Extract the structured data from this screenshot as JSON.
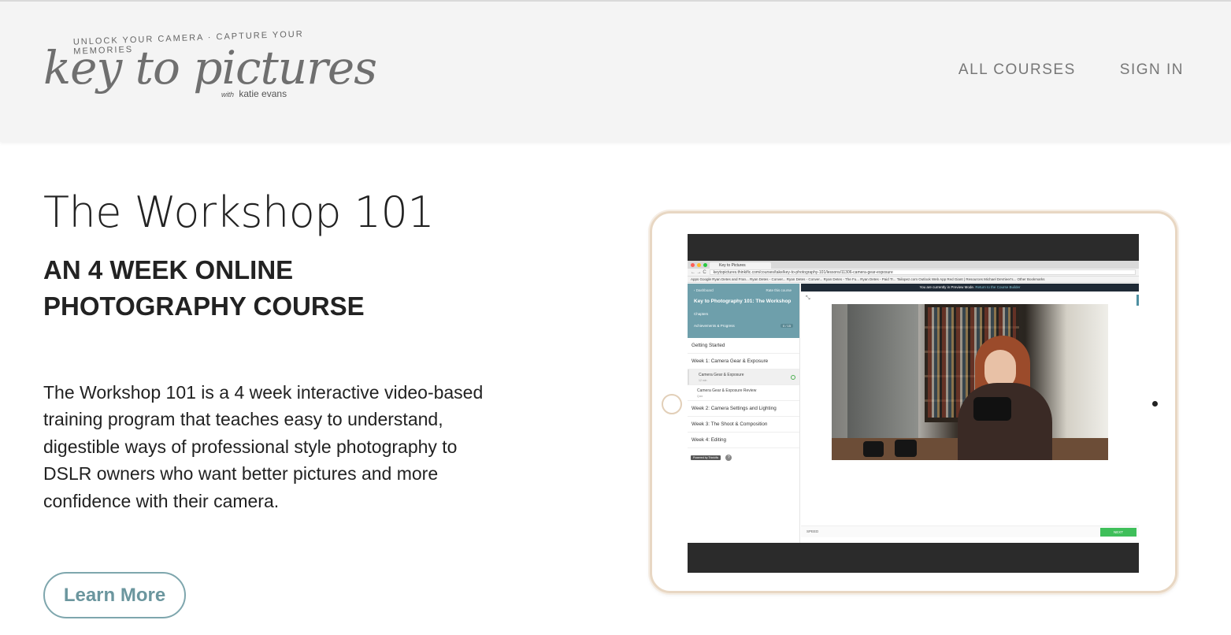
{
  "header": {
    "logo": {
      "tagline": "UNLOCK YOUR CAMERA  ·  CAPTURE YOUR MEMORIES",
      "script": "key to pictures",
      "with": "with",
      "author": "katie evans"
    },
    "nav": [
      {
        "label": "ALL COURSES"
      },
      {
        "label": "SIGN IN"
      }
    ]
  },
  "hero": {
    "title": "The Workshop 101",
    "subtitle": "AN 4 WEEK ONLINE PHOTOGRAPHY COURSE",
    "description": "The Workshop 101 is a 4 week interactive video-based training program that teaches easy to understand, digestible ways of professional style photography to DSLR owners who want better pictures and more confidence with their camera.",
    "button_label": "Learn More"
  },
  "mockup": {
    "browser_tab": "Key to Pictures",
    "url": "keytopictures.thinkific.com/courses/take/key-to-photography-101/lessons/11306-camera-gear-exposure",
    "bookmarks": "Apps   Google   Ryan Detes and Fran...   Ryan Detes - Conver...   Ryan Detes - Conver...   Ryan Detes - The Fu...   Ryan Detes - Paid Tr...   Tailopez.com   Outlook Web App   Red Giant | Resources   Michael DeVrieer's...   Other Bookmarks",
    "sidebar": {
      "dashboard": "‹ Dashboard",
      "rate": "Rate this course",
      "course_title": "Key to Photography 101: The Workshop",
      "chapters": "Chapters",
      "achievements": "Achievements & Progress",
      "progress_badge": "0 / 15",
      "items": [
        {
          "label": "Getting Started"
        },
        {
          "label": "Week 1: Camera Gear & Exposure"
        }
      ],
      "subitems": [
        {
          "label": "Camera Gear & Exposure",
          "meta": "12 min"
        },
        {
          "label": "Camera Gear & Exposure Review",
          "meta": "Quiz"
        }
      ],
      "items_after": [
        {
          "label": "Week 2: Camera Settings and Lighting"
        },
        {
          "label": "Week 3: The Shoot & Composition"
        },
        {
          "label": "Week 4: Editing"
        }
      ],
      "powered_by": "Powered by Thinkific",
      "help": "?"
    },
    "preview_bar": {
      "text": "You are currently in Preview Mode.",
      "link": "Return to the Course Builder"
    },
    "expand_icon": "⤡",
    "speed_label": "SPEED",
    "next_label": "NEXT"
  },
  "colors": {
    "accent": "#6e9fab",
    "button_border": "#7ea6ad",
    "next_green": "#3fbf5a",
    "header_bg": "#f4f4f4"
  }
}
